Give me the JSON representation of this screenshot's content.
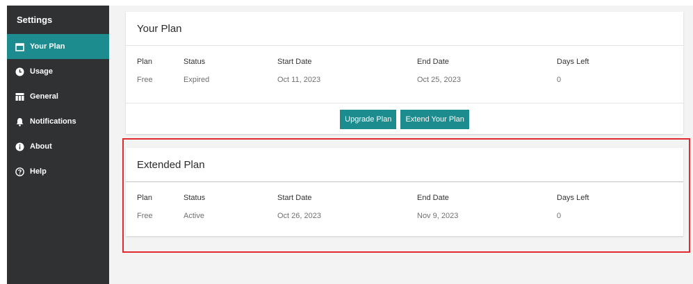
{
  "sidebar": {
    "title": "Settings",
    "items": [
      {
        "label": "Your Plan",
        "icon": "calendar-icon"
      },
      {
        "label": "Usage",
        "icon": "clock-icon"
      },
      {
        "label": "General",
        "icon": "table-icon"
      },
      {
        "label": "Notifications",
        "icon": "bell-icon"
      },
      {
        "label": "About",
        "icon": "info-icon"
      },
      {
        "label": "Help",
        "icon": "help-icon"
      }
    ]
  },
  "your_plan": {
    "title": "Your Plan",
    "headers": [
      "Plan",
      "Status",
      "Start Date",
      "End Date",
      "Days Left"
    ],
    "values": [
      "Free",
      "Expired",
      "Oct 11, 2023",
      "Oct 25, 2023",
      "0"
    ],
    "upgrade_label": "Upgrade Plan",
    "extend_label": "Extend Your Plan"
  },
  "extended_plan": {
    "title": "Extended Plan",
    "headers": [
      "Plan",
      "Status",
      "Start Date",
      "End Date",
      "Days Left"
    ],
    "values": [
      "Free",
      "Active",
      "Oct 26, 2023",
      "Nov 9, 2023",
      "0"
    ]
  },
  "colors": {
    "accent": "#1d8c8f",
    "sidebar_bg": "#303133",
    "highlight": "#e02a2f"
  }
}
